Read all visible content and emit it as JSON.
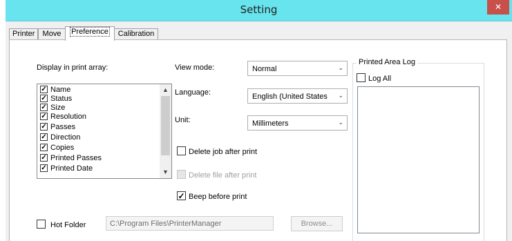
{
  "window": {
    "title": "Setting",
    "close_symbol": "✕"
  },
  "tabs": [
    {
      "label": "Printer",
      "active": false
    },
    {
      "label": "Move",
      "active": false
    },
    {
      "label": "Preference",
      "active": true
    },
    {
      "label": "Calibration",
      "active": false
    }
  ],
  "display_array": {
    "label": "Display in print array:",
    "items": [
      {
        "label": "Name",
        "checked": true
      },
      {
        "label": "Status",
        "checked": true
      },
      {
        "label": "Size",
        "checked": true
      },
      {
        "label": "Resolution",
        "checked": true
      },
      {
        "label": "Passes",
        "checked": true
      },
      {
        "label": "Direction",
        "checked": true
      },
      {
        "label": "Copies",
        "checked": true
      },
      {
        "label": "Printed Passes",
        "checked": true
      },
      {
        "label": "Printed Date",
        "checked": true
      }
    ],
    "scroll_up_icon": "▲",
    "scroll_down_icon": "▼"
  },
  "view_mode": {
    "label": "View mode:",
    "value": "Normal"
  },
  "language": {
    "label": "Language:",
    "value": "English (United States"
  },
  "unit": {
    "label": "Unit:",
    "value": "Millimeters"
  },
  "dropdown_arrow": "⌄",
  "options": {
    "delete_job": {
      "label": "Delete job after print",
      "checked": false,
      "enabled": true
    },
    "delete_file": {
      "label": "Delete file after print",
      "checked": false,
      "enabled": false
    },
    "beep": {
      "label": "Beep before print",
      "checked": true,
      "enabled": true
    }
  },
  "printed_area_log": {
    "title": "Printed Area Log",
    "log_all_label": "Log All",
    "log_all_checked": false
  },
  "hot_folder": {
    "label": "Hot Folder",
    "checked": false,
    "path": "C:\\Program Files\\PrinterManager",
    "browse_label": "Browse..."
  }
}
